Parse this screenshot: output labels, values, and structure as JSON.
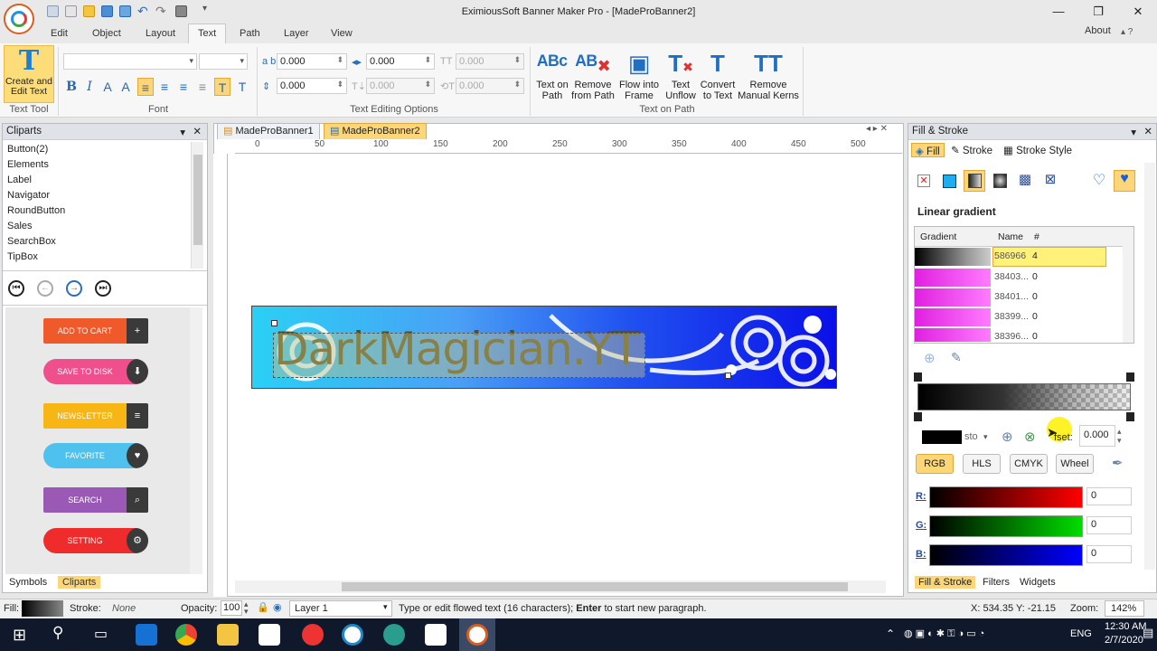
{
  "window": {
    "title": "EximiousSoft Banner Maker Pro - [MadeProBanner2]",
    "about": "About",
    "min_icon": "minimize-icon",
    "max_icon": "maximize-icon",
    "close_icon": "close-icon"
  },
  "menu": [
    "Edit",
    "Object",
    "Layout",
    "Text",
    "Path",
    "Layer",
    "View"
  ],
  "menu_active": "Text",
  "ribbon": {
    "text_tool": {
      "button": "Create and Edit Text",
      "group": "Text Tool"
    },
    "font_group": "Font",
    "editing_group": "Text Editing Options",
    "spin_values": [
      "0.000",
      "0.000",
      "0.000",
      "0.000",
      "0.000",
      "0.000"
    ],
    "text_on_path_group": "Text on Path",
    "path_buttons": [
      {
        "l1": "Text on",
        "l2": "Path"
      },
      {
        "l1": "Remove",
        "l2": "from Path"
      },
      {
        "l1": "Flow into",
        "l2": "Frame"
      },
      {
        "l1": "Text",
        "l2": "Unflow"
      },
      {
        "l1": "Convert",
        "l2": "to Text"
      },
      {
        "l1": "Remove",
        "l2": "Manual Kerns"
      }
    ]
  },
  "cliparts": {
    "title": "Cliparts",
    "items": [
      "Button(2)",
      "Elements",
      "Label",
      "Navigator",
      "RoundButton",
      "Sales",
      "SearchBox",
      "TipBox"
    ],
    "buttons": [
      {
        "label": "ADD TO CART",
        "color": "#f0592a"
      },
      {
        "label": "SAVE TO DISK",
        "color": "#ef4f8d"
      },
      {
        "label": "NEWSLETTER",
        "color": "#f7b614"
      },
      {
        "label": "FAVORITE",
        "color": "#4fc1ee"
      },
      {
        "label": "SEARCH",
        "color": "#9b59b6"
      },
      {
        "label": "SETTING",
        "color": "#ef2b2b"
      }
    ],
    "tabs": [
      "Symbols",
      "Cliparts"
    ]
  },
  "documents": {
    "tabs": [
      "MadeProBanner1",
      "MadeProBanner2"
    ],
    "active": 1
  },
  "ruler": {
    "h": [
      "0",
      "50",
      "100",
      "150",
      "200",
      "250",
      "300",
      "350",
      "400",
      "450",
      "500"
    ]
  },
  "banner": {
    "text": "DarkMagician.YT"
  },
  "fill_stroke": {
    "title": "Fill & Stroke",
    "tabs": [
      "Fill",
      "Stroke",
      "Stroke Style"
    ],
    "mode_label": "Linear gradient",
    "cols": [
      "Gradient",
      "Name",
      "#"
    ],
    "gradients": [
      {
        "name": "586966",
        "count": "4",
        "selected": true
      },
      {
        "name": "38403...",
        "count": "0"
      },
      {
        "name": "38401...",
        "count": "0"
      },
      {
        "name": "38399...",
        "count": "0"
      },
      {
        "name": "38396...",
        "count": "0"
      }
    ],
    "stop_label": "sto",
    "offset_label": "fset:",
    "offset_value": "0.000",
    "color_modes": [
      "RGB",
      "HLS",
      "CMYK",
      "Wheel"
    ],
    "active_mode": "RGB",
    "channels": [
      {
        "label": "R:",
        "value": "0"
      },
      {
        "label": "G:",
        "value": "0"
      },
      {
        "label": "B:",
        "value": "0"
      }
    ],
    "bottom_tabs": [
      "Fill & Stroke",
      "Filters",
      "Widgets"
    ]
  },
  "status": {
    "fill": "Fill:",
    "stroke": "Stroke:",
    "stroke_value": "None",
    "opacity": "Opacity:",
    "opacity_value": "100",
    "layer": "Layer 1",
    "message_pre": "Type or edit flowed text (16 characters); ",
    "message_key": "Enter",
    "message_post": " to start new paragraph.",
    "coords": "X: 534.35 Y: -21.15",
    "zoom": "Zoom:",
    "zoom_value": "142%"
  },
  "taskbar": {
    "lang": "ENG",
    "time": "12:30 AM",
    "date": "2/7/2020"
  }
}
